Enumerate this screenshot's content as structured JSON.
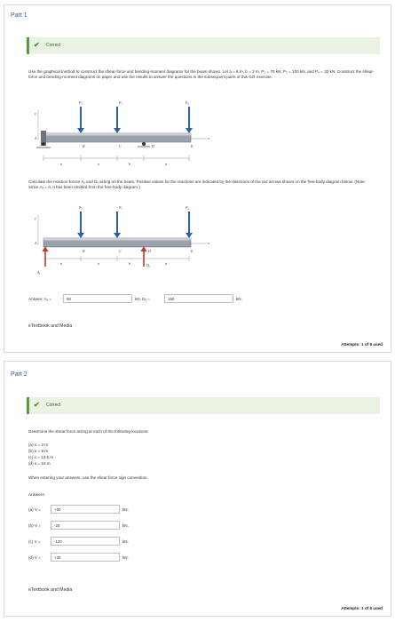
{
  "part1": {
    "title": "Part 1",
    "status": "Correct",
    "problem_text": "Use the graphical method to construct the shear-force and bending-moment diagrams for the beam shown. Let a = 6 m, b = 3 m, P₂ = 70 kN, P₃ = 100 kN, and P₄ = 30 kN. Construct the shear-force and bending-moment diagrams on paper and use the results to answer the questions in the subsequent parts of this GO exercise.",
    "diagram": {
      "loads": [
        "P₂",
        "P₃",
        "P₄"
      ],
      "points": [
        "A",
        "B",
        "C",
        "D",
        "E"
      ],
      "dims": [
        "a",
        "a",
        "b",
        "a"
      ],
      "axis_x": "x",
      "axis_y": "y"
    },
    "instruction_text": "Calculate the reaction forces Aᵧ and Dᵧ acting on the beam. Positive values for the reactions are indicated by the directions of the red arrows shown on the free-body diagram below. (Note: Since Aₓ = 0, it has been omitted from the free-body diagram.)",
    "fbd": {
      "loads": [
        "P₂",
        "P₃",
        "P₄"
      ],
      "points": [
        "A",
        "B",
        "C",
        "D",
        "E"
      ],
      "reactions": [
        "Aᵧ",
        "Dᵧ"
      ],
      "dims": [
        "a",
        "a",
        "b",
        "a"
      ],
      "axis_x": "x",
      "axis_y": "y"
    },
    "answer_label": "Answer: Aᵧ =",
    "ay_value": "50",
    "ay_unit": "kN, Dᵧ =",
    "dy_value": "150",
    "dy_unit": "kN.",
    "etextbook": "eTextbook and Media",
    "attempts": "Attempts: 1 of 5 used"
  },
  "part2": {
    "title": "Part 2",
    "status": "Correct",
    "question": "Determine the shear force acting at each of the following locations:",
    "locations": [
      "(a) x = 3 m",
      "(b) x = 9 m",
      "(c) x = 13.5 m",
      "(d) x = 18 m"
    ],
    "convention": "When entering your answers, use the shear force sign convention.",
    "answers_label": "Answers:",
    "answers": [
      {
        "label": "(a) V =",
        "value": "+50",
        "unit": "kN."
      },
      {
        "label": "(b) V =",
        "value": "-20",
        "unit": "kN."
      },
      {
        "label": "(c) V =",
        "value": "-120",
        "unit": "kN."
      },
      {
        "label": "(d) V =",
        "value": "+30",
        "unit": "kN."
      }
    ],
    "etextbook": "eTextbook and Media",
    "attempts": "Attempts: 1 of 5 used"
  },
  "colors": {
    "accent": "#2a5db0",
    "correct_bg": "#eaf3e3",
    "correct_bar": "#5a9a3a",
    "load_arrow": "#2c5f9e",
    "reaction_arrow": "#c0392b"
  }
}
